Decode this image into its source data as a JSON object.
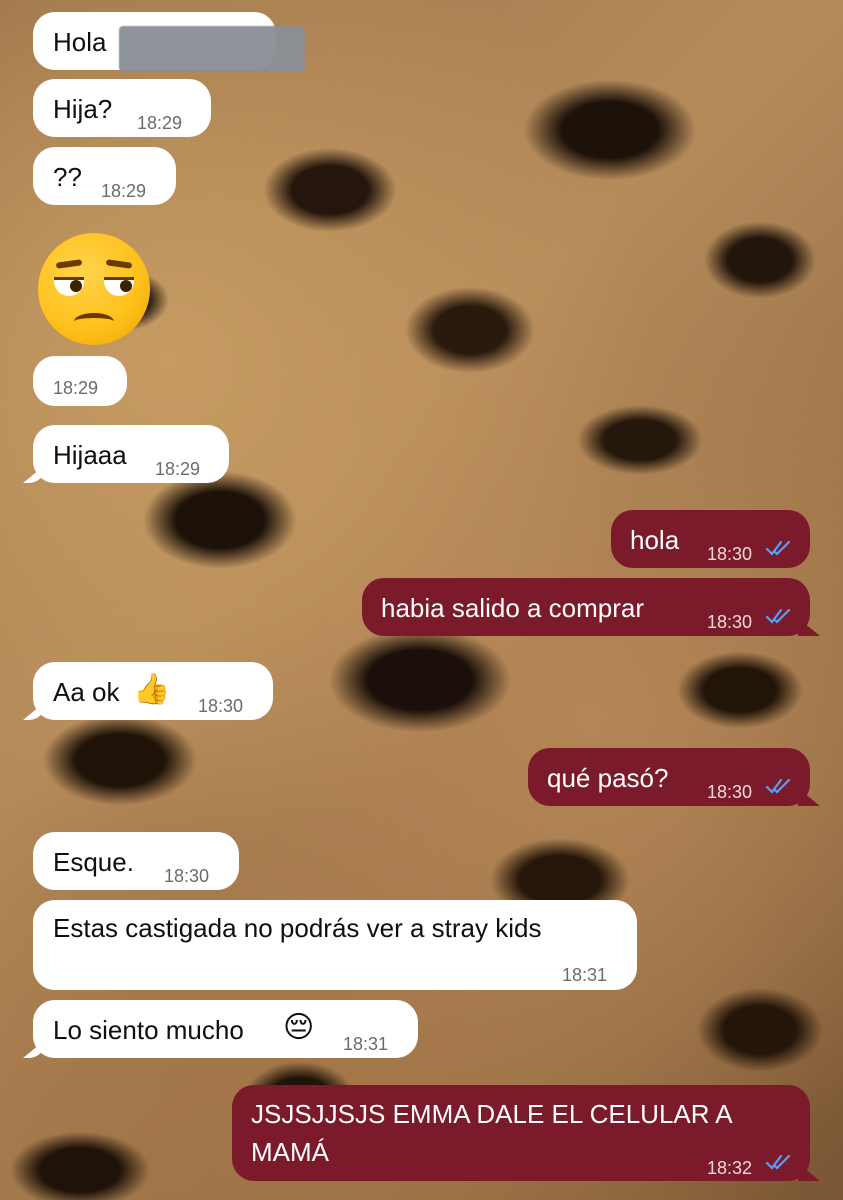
{
  "chat": {
    "messages": [
      {
        "text": "Hola",
        "time": ""
      },
      {
        "text": "Hija?",
        "time": "18:29"
      },
      {
        "text": "??",
        "time": "18:29"
      },
      {
        "time": "18:29"
      },
      {
        "text": "Hijaaa",
        "time": "18:29"
      },
      {
        "text": "hola",
        "time": "18:30"
      },
      {
        "text": "habia salido a comprar",
        "time": "18:30"
      },
      {
        "text": "Aa ok",
        "emoji": "👍",
        "time": "18:30"
      },
      {
        "text": "qué pasó?",
        "time": "18:30"
      },
      {
        "text": "Esque.",
        "time": "18:30"
      },
      {
        "text": "Estas castigada no podrás ver a stray kids",
        "time": "18:31"
      },
      {
        "text": "Lo siento mucho",
        "emoji": "😔",
        "time": "18:31"
      },
      {
        "text_line1": "JSJSJJSJS EMMA DALE EL CELULAR A",
        "text_line2": "MAMÁ",
        "time": "18:32"
      }
    ]
  },
  "icons": {
    "sticker": "unamused-face-emoji",
    "read_receipt": "double-check-icon"
  },
  "colors": {
    "incoming_bubble": "#ffffff",
    "outgoing_bubble": "#7b1a2a",
    "read_check": "#4fa3ff"
  }
}
